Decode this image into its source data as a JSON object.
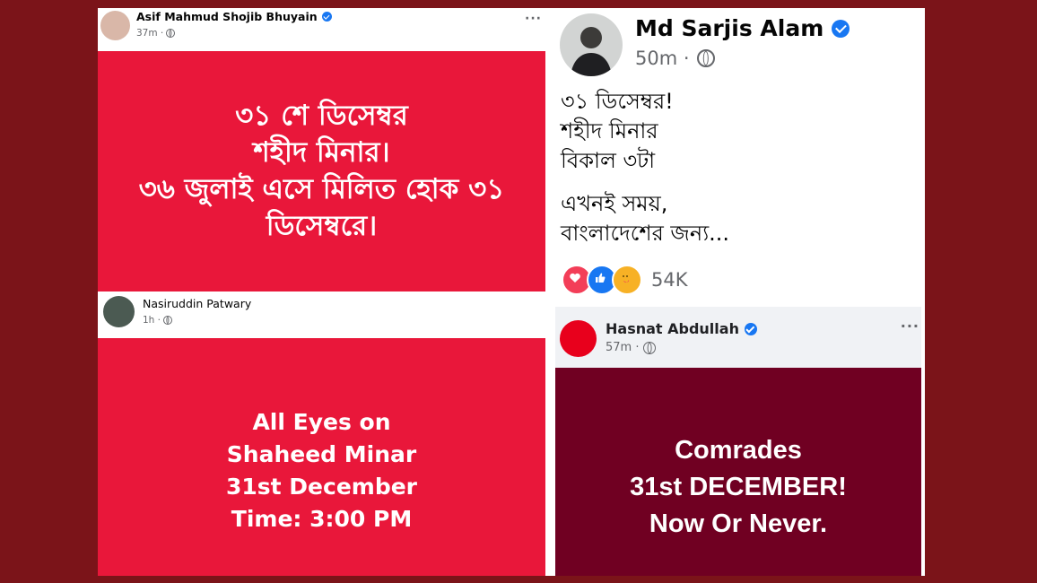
{
  "posts": [
    {
      "author": "Asif Mahmud Shojib Bhuyain",
      "time": "37m ·",
      "more": "···",
      "panel_lines": [
        "৩১ শে ডিসেম্বর",
        "শহীদ মিনার।",
        "৩৬ জুলাই এসে মিলিত হোক ৩১",
        "ডিসেম্বরে।"
      ],
      "panel_color": "#e9173a"
    },
    {
      "author": "Nasiruddin Patwary",
      "time": "1h ·",
      "panel_lines": [
        "All Eyes on",
        "Shaheed Minar",
        "31st December",
        "Time: 3:00 PM"
      ],
      "panel_color": "#e9173a"
    },
    {
      "author": "Md Sarjis Alam",
      "time": "50m ·",
      "body_lines_1": [
        "৩১ ডিসেম্বর!",
        "শহীদ মিনার",
        "বিকাল ৩টা"
      ],
      "body_lines_2": [
        "এখনই সময়,",
        "বাংলাদেশের জন্য..."
      ],
      "reaction_icons": [
        "love",
        "like",
        "care"
      ],
      "reaction_count": "54K"
    },
    {
      "author": "Hasnat Abdullah",
      "time": "57m ·",
      "more": "···",
      "panel_lines": [
        "Comrades",
        "31st DECEMBER!",
        "Now Or Never."
      ],
      "panel_color": "#700022"
    }
  ],
  "colors": {
    "background": "#7b1419",
    "facebook_blue": "#1877f2"
  }
}
